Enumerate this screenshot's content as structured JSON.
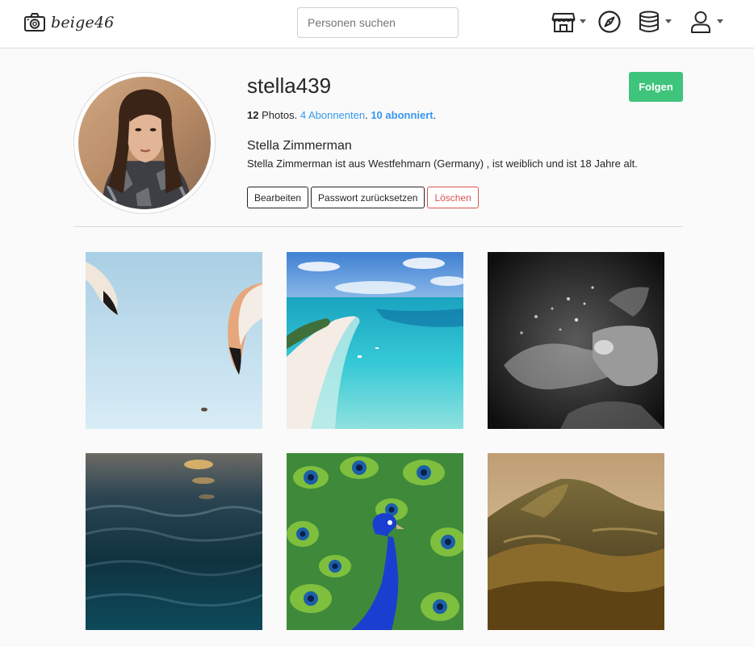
{
  "brand": {
    "name": "beige46",
    "icon": "camera-icon"
  },
  "search": {
    "placeholder": "Personen suchen",
    "value": ""
  },
  "nav": {
    "icons": [
      "store-icon",
      "compass-icon",
      "database-icon",
      "user-icon"
    ]
  },
  "profile": {
    "username": "stella439",
    "follow_label": "Folgen",
    "stats": {
      "photos_count": "12",
      "photos_label": "Photos.",
      "followers_count": "4",
      "followers_label": "Abonnenten",
      "following_count": "10",
      "following_label": "abonniert"
    },
    "full_name": "Stella Zimmerman",
    "bio": "Stella Zimmerman ist aus Westfehmarn (Germany) , ist weiblich und ist 18 Jahre alt.",
    "buttons": {
      "edit": "Bearbeiten",
      "reset_password": "Passwort zurücksetzen",
      "delete": "Löschen"
    }
  },
  "colors": {
    "accent_green": "#3ec47b",
    "link_blue": "#3897f0",
    "danger_red": "#d9534f"
  },
  "photos": [
    {
      "subject": "flamingos on light blue"
    },
    {
      "subject": "tropical beach with turquoise water"
    },
    {
      "subject": "black and white dispersion portrait"
    },
    {
      "subject": "dark ocean water at sunset"
    },
    {
      "subject": "peacock with spread feathers"
    },
    {
      "subject": "golden rolling hills"
    }
  ]
}
